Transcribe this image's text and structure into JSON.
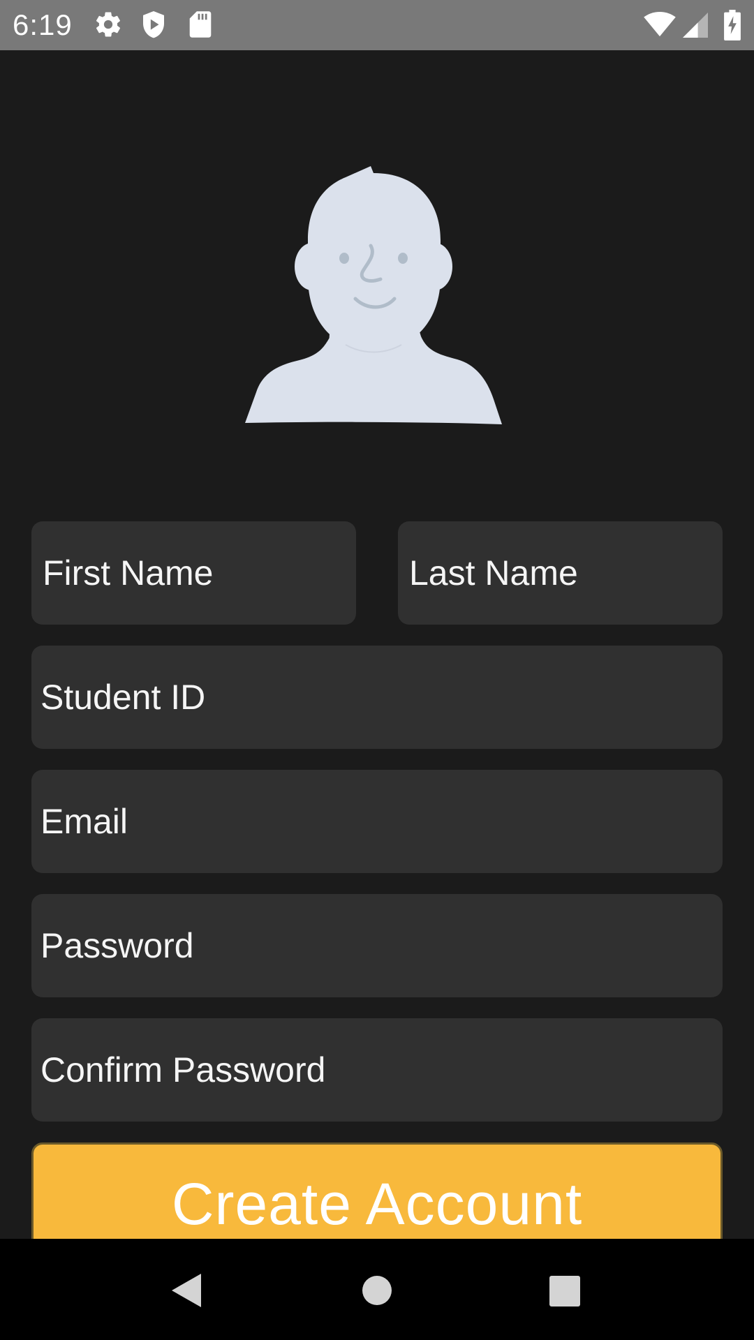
{
  "status_bar": {
    "time": "6:19",
    "left_icons": [
      "gear-icon",
      "shield-play-icon",
      "sd-card-icon"
    ],
    "right_icons": [
      "wifi-icon",
      "signal-icon",
      "battery-charging-icon"
    ]
  },
  "avatar": {
    "icon": "person-avatar-icon",
    "color": "#dbe1ec"
  },
  "form": {
    "first_name_placeholder": "First Name",
    "last_name_placeholder": "Last Name",
    "student_id_placeholder": "Student ID",
    "email_placeholder": "Email",
    "password_placeholder": "Password",
    "confirm_password_placeholder": "Confirm Password",
    "submit_label": "Create Account"
  },
  "colors": {
    "background": "#1b1b1b",
    "field_background": "#303030",
    "accent": "#f8b93c",
    "status_bar": "#797979",
    "nav_bar": "#000000"
  },
  "nav_bar": {
    "items": [
      "back-icon",
      "home-icon",
      "recents-icon"
    ]
  }
}
